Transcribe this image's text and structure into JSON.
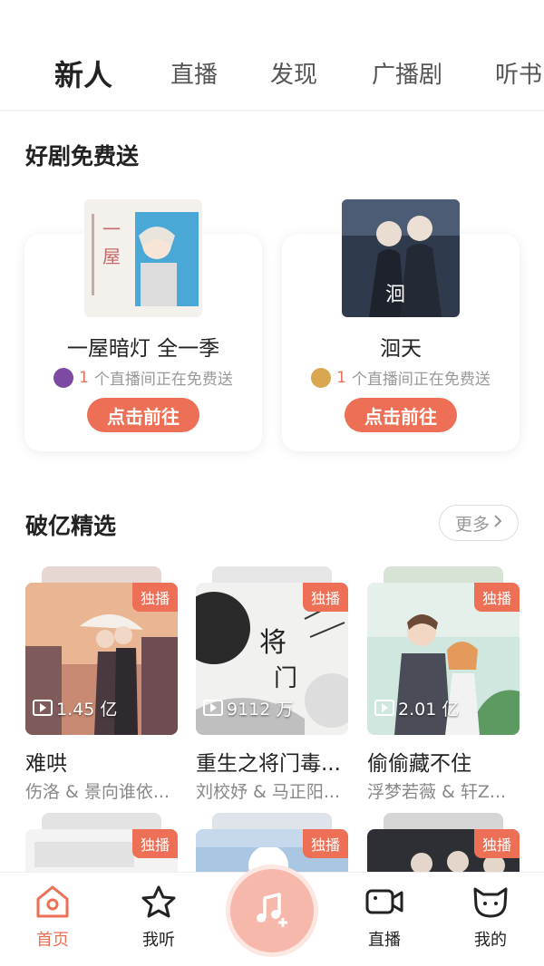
{
  "tabs": [
    {
      "label": "新人",
      "active": true
    },
    {
      "label": "直播",
      "active": false
    },
    {
      "label": "发现",
      "active": false
    },
    {
      "label": "广播剧",
      "active": false
    },
    {
      "label": "听书",
      "active": false
    }
  ],
  "free_section": {
    "title": "好剧免费送",
    "cards": [
      {
        "name": "一屋暗灯 全一季",
        "count": "1",
        "text": "个直播间正在免费送",
        "button": "点击前往"
      },
      {
        "name": "洄天",
        "count": "1",
        "text": "个直播间正在免费送",
        "button": "点击前往"
      }
    ]
  },
  "featured_section": {
    "title": "破亿精选",
    "more_label": "更多",
    "albums": [
      {
        "title": "难哄",
        "authors": "伤洛 & 景向谁依...",
        "badge": "独播",
        "plays": "1.45 亿"
      },
      {
        "title": "重生之将门毒...",
        "authors": "刘校妤 & 马正阳...",
        "badge": "独播",
        "plays": "9112 万"
      },
      {
        "title": "偷偷藏不住",
        "authors": "浮梦若薇 & 轩Z...",
        "badge": "独播",
        "plays": "2.01 亿"
      },
      {
        "title": "",
        "authors": "",
        "badge": "独播",
        "plays": ""
      },
      {
        "title": "",
        "authors": "",
        "badge": "独播",
        "plays": ""
      },
      {
        "title": "",
        "authors": "",
        "badge": "独播",
        "plays": ""
      }
    ]
  },
  "bottom_nav": [
    {
      "label": "首页",
      "icon": "home-icon",
      "active": true
    },
    {
      "label": "我听",
      "icon": "star-icon",
      "active": false
    },
    {
      "label": "",
      "icon": "music-add-icon",
      "active": false
    },
    {
      "label": "直播",
      "icon": "video-camera-icon",
      "active": false
    },
    {
      "label": "我的",
      "icon": "cat-face-icon",
      "active": false
    }
  ],
  "colors": {
    "accent": "#ec6f56",
    "text": "#222222",
    "muted": "#999999"
  }
}
